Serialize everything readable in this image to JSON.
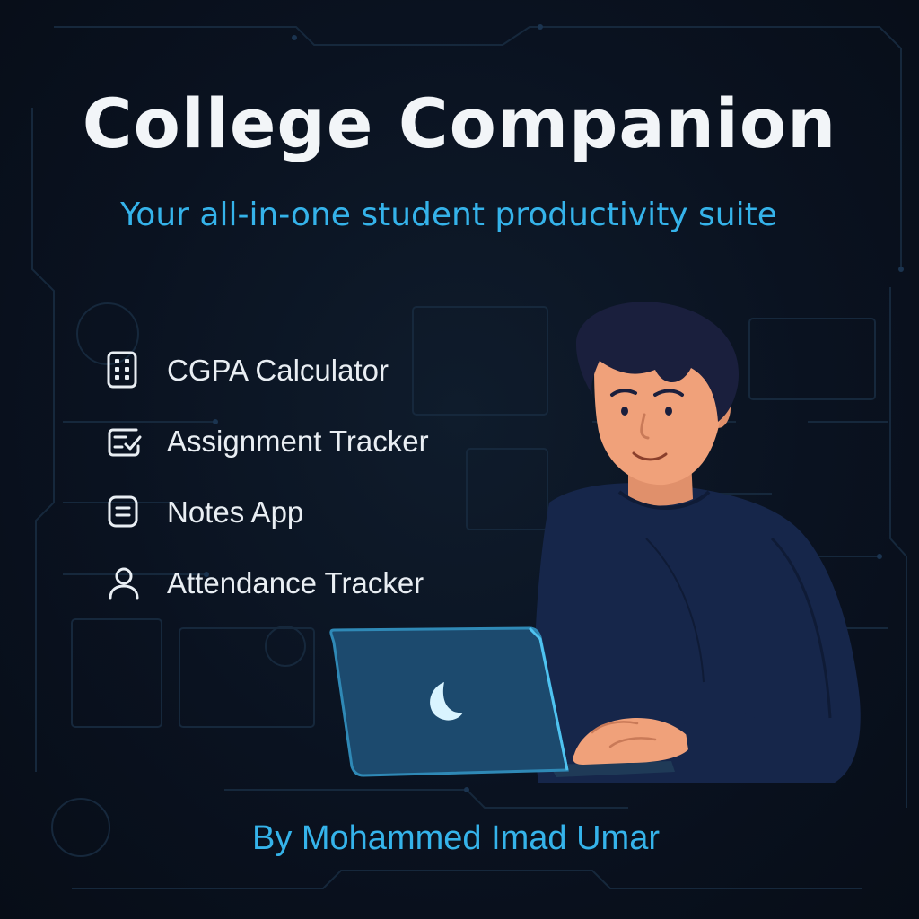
{
  "poster": {
    "title": "College Companion",
    "subtitle": "Your all-in-one student productivity suite",
    "features": [
      {
        "label": "CGPA Calculator",
        "icon": "calculator-icon"
      },
      {
        "label": "Assignment Tracker",
        "icon": "checklist-icon"
      },
      {
        "label": "Notes App",
        "icon": "notes-icon"
      },
      {
        "label": "Attendance Tracker",
        "icon": "user-icon"
      }
    ],
    "illustration": {
      "subject": "student-with-laptop",
      "laptop_logo": "crescent-moon-icon"
    },
    "credit": "By Mohammed Imad Umar"
  },
  "colors": {
    "background": "#0b1320",
    "title": "#f2f5f8",
    "accent": "#35b3ea",
    "feature_text": "#e9eef3",
    "hair": "#1a1f3d",
    "skin": "#f0a17a",
    "sweater": "#16264a",
    "laptop": "#1c4a6e"
  }
}
